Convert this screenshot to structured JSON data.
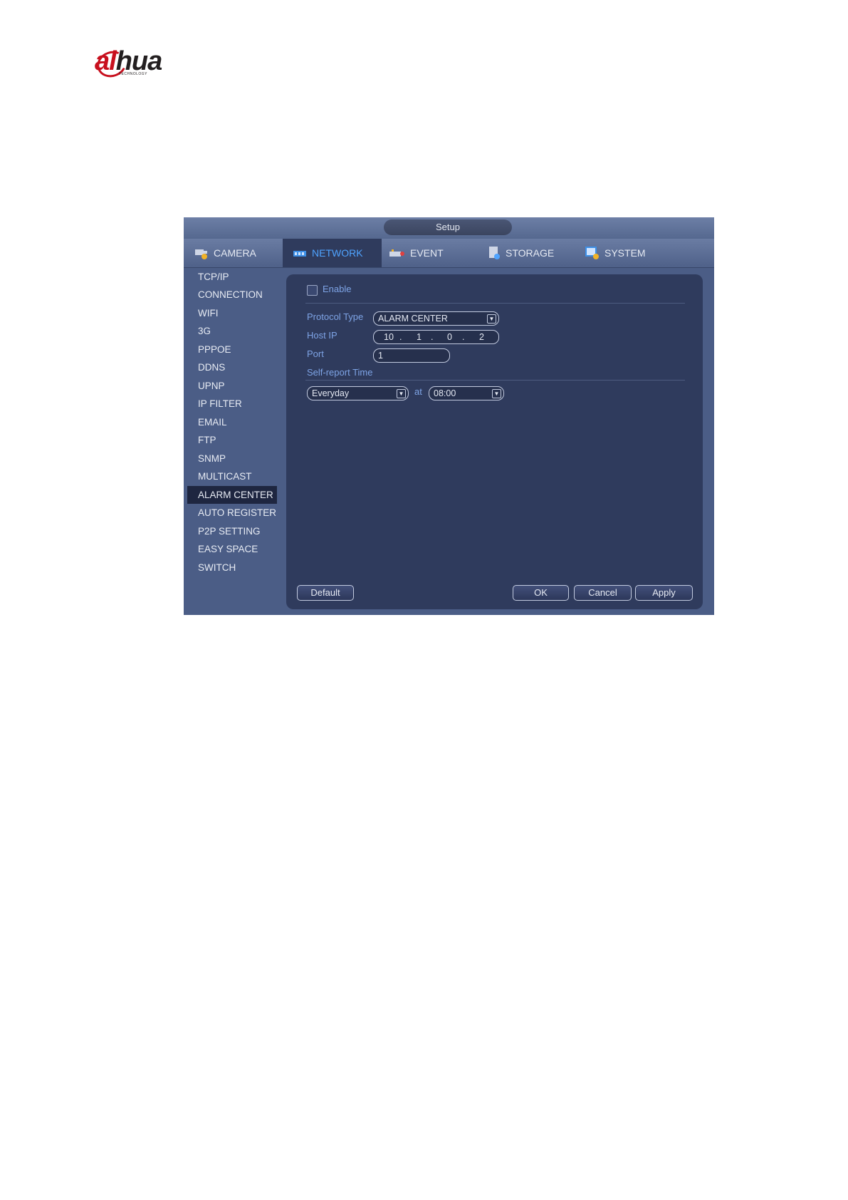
{
  "logo": {
    "brand": "alhua",
    "tagline": "TECHNOLOGY"
  },
  "window": {
    "title": "Setup"
  },
  "tabs": [
    {
      "label": "CAMERA",
      "icon": "camera-icon"
    },
    {
      "label": "NETWORK",
      "icon": "network-icon",
      "active": true
    },
    {
      "label": "EVENT",
      "icon": "event-icon"
    },
    {
      "label": "STORAGE",
      "icon": "storage-icon"
    },
    {
      "label": "SYSTEM",
      "icon": "system-icon"
    }
  ],
  "sidebar": {
    "items": [
      {
        "label": "TCP/IP"
      },
      {
        "label": "CONNECTION"
      },
      {
        "label": "WIFI"
      },
      {
        "label": "3G"
      },
      {
        "label": "PPPOE"
      },
      {
        "label": "DDNS"
      },
      {
        "label": "UPNP"
      },
      {
        "label": "IP FILTER"
      },
      {
        "label": "EMAIL"
      },
      {
        "label": "FTP"
      },
      {
        "label": "SNMP"
      },
      {
        "label": "MULTICAST"
      },
      {
        "label": "ALARM CENTER",
        "active": true
      },
      {
        "label": "AUTO REGISTER"
      },
      {
        "label": "P2P SETTING"
      },
      {
        "label": "EASY SPACE"
      },
      {
        "label": "SWITCH"
      }
    ]
  },
  "form": {
    "enable_label": "Enable",
    "enable_checked": false,
    "protocol_type_label": "Protocol Type",
    "protocol_type_value": "ALARM CENTER",
    "host_ip_label": "Host IP",
    "host_ip": [
      "10",
      "1",
      "0",
      "2"
    ],
    "port_label": "Port",
    "port_value": "1",
    "self_report_label": "Self-report Time",
    "period_value": "Everyday",
    "at_label": "at",
    "time_value": "08:00"
  },
  "buttons": {
    "default": "Default",
    "ok": "OK",
    "cancel": "Cancel",
    "apply": "Apply"
  },
  "colors": {
    "window_bg": "#4b5d86",
    "panel_bg": "#2f3b5d",
    "label_blue": "#7ea4e6",
    "active_tab_text": "#4fa3ff",
    "logo_red": "#c8101e"
  }
}
